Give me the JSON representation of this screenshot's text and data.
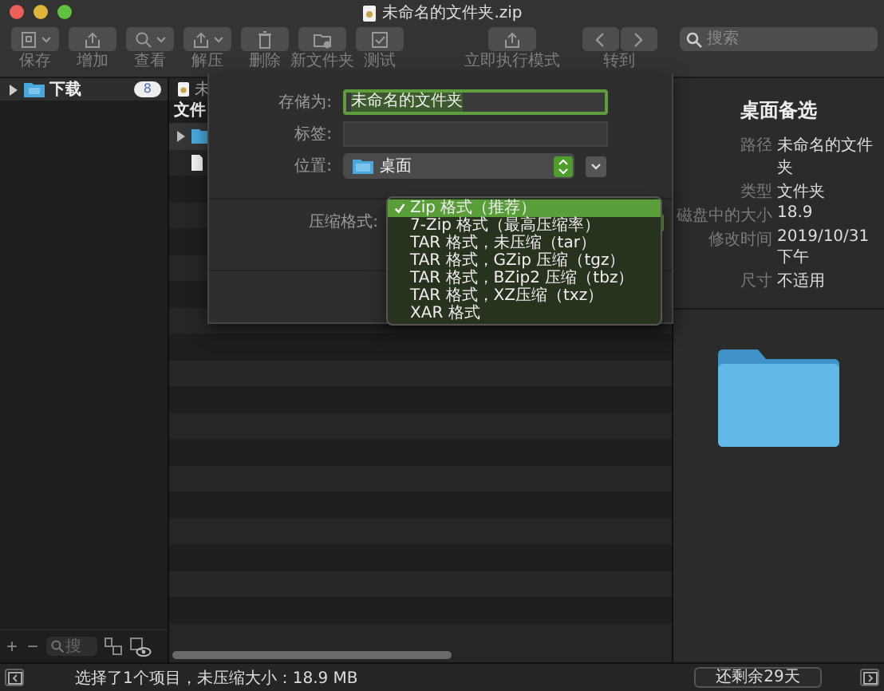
{
  "window": {
    "title": "未命名的文件夹.zip"
  },
  "toolbar": {
    "items": [
      {
        "label": "保存",
        "has_menu": true
      },
      {
        "label": "增加",
        "has_menu": false
      },
      {
        "label": "查看",
        "has_menu": true
      },
      {
        "label": "解压",
        "has_menu": true
      },
      {
        "label": "删除",
        "has_menu": false
      },
      {
        "label": "新文件夹",
        "has_menu": false
      },
      {
        "label": "测试",
        "has_menu": false
      },
      {
        "label": "立即执行模式",
        "has_menu": false
      }
    ],
    "nav": {
      "label": "转到"
    },
    "search": {
      "placeholder": "搜索"
    }
  },
  "sidebar": {
    "items": [
      {
        "label": "下载",
        "count": "8",
        "expanded": false,
        "selected": true
      }
    ],
    "footer_buttons": [
      "+",
      "−"
    ],
    "search": {
      "placeholder": "搜"
    }
  },
  "file_list": {
    "tab": "未",
    "header": "文件",
    "rows": [
      {
        "kind": "folder",
        "expanded": false,
        "selected": true
      },
      {
        "kind": "file",
        "selected": false
      }
    ]
  },
  "sheet": {
    "save_as": {
      "label": "存储为:",
      "value": "未命名的文件夹"
    },
    "tags": {
      "label": "标签:"
    },
    "location": {
      "label": "位置:",
      "value": "桌面"
    },
    "format": {
      "label": "压缩格式:"
    },
    "options": [
      {
        "label": "Zip 格式（推荐）",
        "selected": true
      },
      {
        "label": "7-Zip 格式（最高压缩率）",
        "selected": false
      },
      {
        "label": "TAR 格式，未压缩（tar）",
        "selected": false
      },
      {
        "label": "TAR 格式，GZip 压缩（tgz）",
        "selected": false
      },
      {
        "label": "TAR 格式，BZip2 压缩（tbz）",
        "selected": false
      },
      {
        "label": "TAR 格式，XZ压缩（txz）",
        "selected": false
      },
      {
        "label": "XAR 格式",
        "selected": false
      }
    ]
  },
  "info": {
    "title": "桌面备选",
    "rows": [
      {
        "label": "路径",
        "value": "未命名的文件夹"
      },
      {
        "label": "类型",
        "value": "文件夹"
      },
      {
        "label": "磁盘中的大小",
        "value": "18.9"
      },
      {
        "label": "修改时间",
        "value": "2019/10/31 下午"
      },
      {
        "label": "尺寸",
        "value": "不适用"
      }
    ]
  },
  "status_bar": {
    "text": "选择了1个项目，未压缩大小：18.9 MB",
    "trial": "还剩余29天"
  }
}
